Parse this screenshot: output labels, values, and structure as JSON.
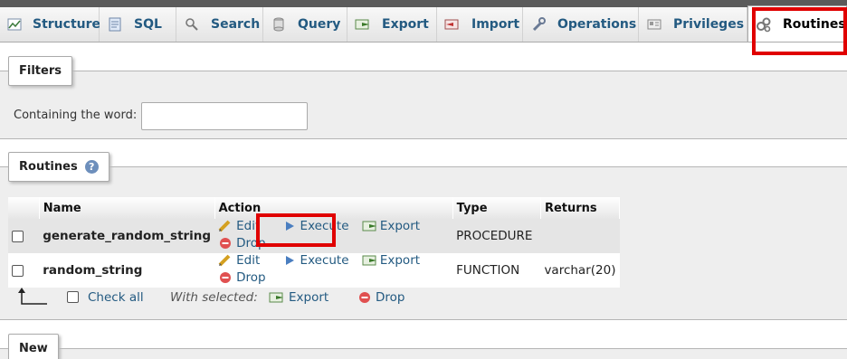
{
  "tabs": [
    {
      "label": "Structure",
      "icon": "structure-icon"
    },
    {
      "label": "SQL",
      "icon": "sql-icon"
    },
    {
      "label": "Search",
      "icon": "search-icon"
    },
    {
      "label": "Query",
      "icon": "query-icon"
    },
    {
      "label": "Export",
      "icon": "export-icon"
    },
    {
      "label": "Import",
      "icon": "import-icon"
    },
    {
      "label": "Operations",
      "icon": "wrench-icon"
    },
    {
      "label": "Privileges",
      "icon": "privileges-icon"
    },
    {
      "label": "Routines",
      "icon": "routines-icon",
      "active": true
    }
  ],
  "filters": {
    "legend": "Filters",
    "containing_label": "Containing the word:",
    "containing_value": ""
  },
  "routines": {
    "legend": "Routines",
    "help_glyph": "?",
    "columns": [
      "Name",
      "Action",
      "Type",
      "Returns"
    ],
    "rows": [
      {
        "name": "generate_random_string",
        "actions": [
          "Edit",
          "Execute",
          "Export",
          "Drop"
        ],
        "type": "PROCEDURE",
        "returns": ""
      },
      {
        "name": "random_string",
        "actions": [
          "Edit",
          "Execute",
          "Export",
          "Drop"
        ],
        "type": "FUNCTION",
        "returns": "varchar(20)"
      }
    ],
    "check_all": "Check all",
    "with_selected": "With selected:",
    "bulk_export": "Export",
    "bulk_drop": "Drop"
  },
  "new_section": {
    "legend": "New"
  },
  "colors": {
    "link": "#235a81",
    "highlight": "#e00000",
    "panel": "#eeeeee"
  }
}
